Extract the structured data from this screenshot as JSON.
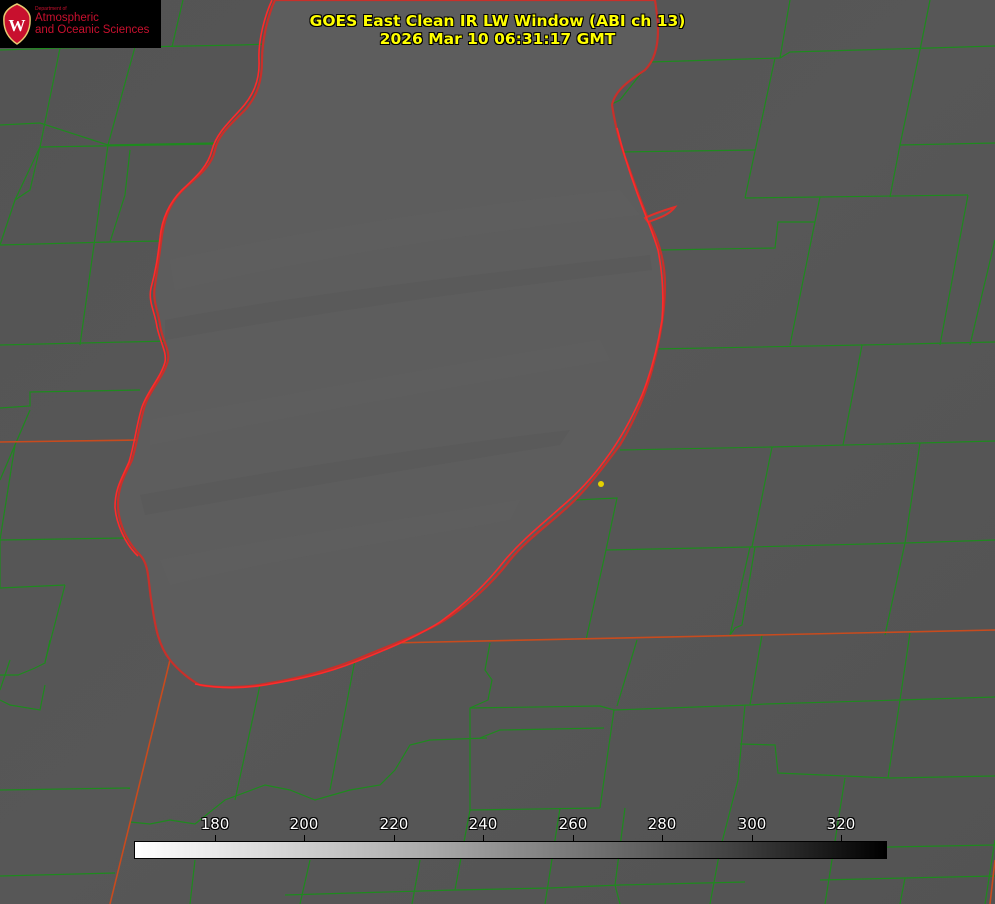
{
  "header": {
    "title_line1": "GOES East Clean IR LW Window (ABI ch 13)",
    "title_line2": "2026 Mar 10 06:31:17 GMT"
  },
  "logo": {
    "dept_small": "Department of",
    "line1": "Atmospheric",
    "line2": "and Oceanic Sciences",
    "seal_letter": "W"
  },
  "colorbar": {
    "ticks": [
      "180",
      "200",
      "220",
      "240",
      "260",
      "280",
      "300",
      "320"
    ]
  },
  "colors": {
    "title": "#ffff00",
    "county_lines": "#1e8a1e",
    "state_lines": "#c84b1e",
    "lake_outline": "#ff2a2a",
    "background": "#565656",
    "lake_fill": "#5d5d5d",
    "marker": "#e4d100"
  },
  "icons": {
    "marker": "location-dot-icon",
    "seal": "university-seal-icon"
  }
}
